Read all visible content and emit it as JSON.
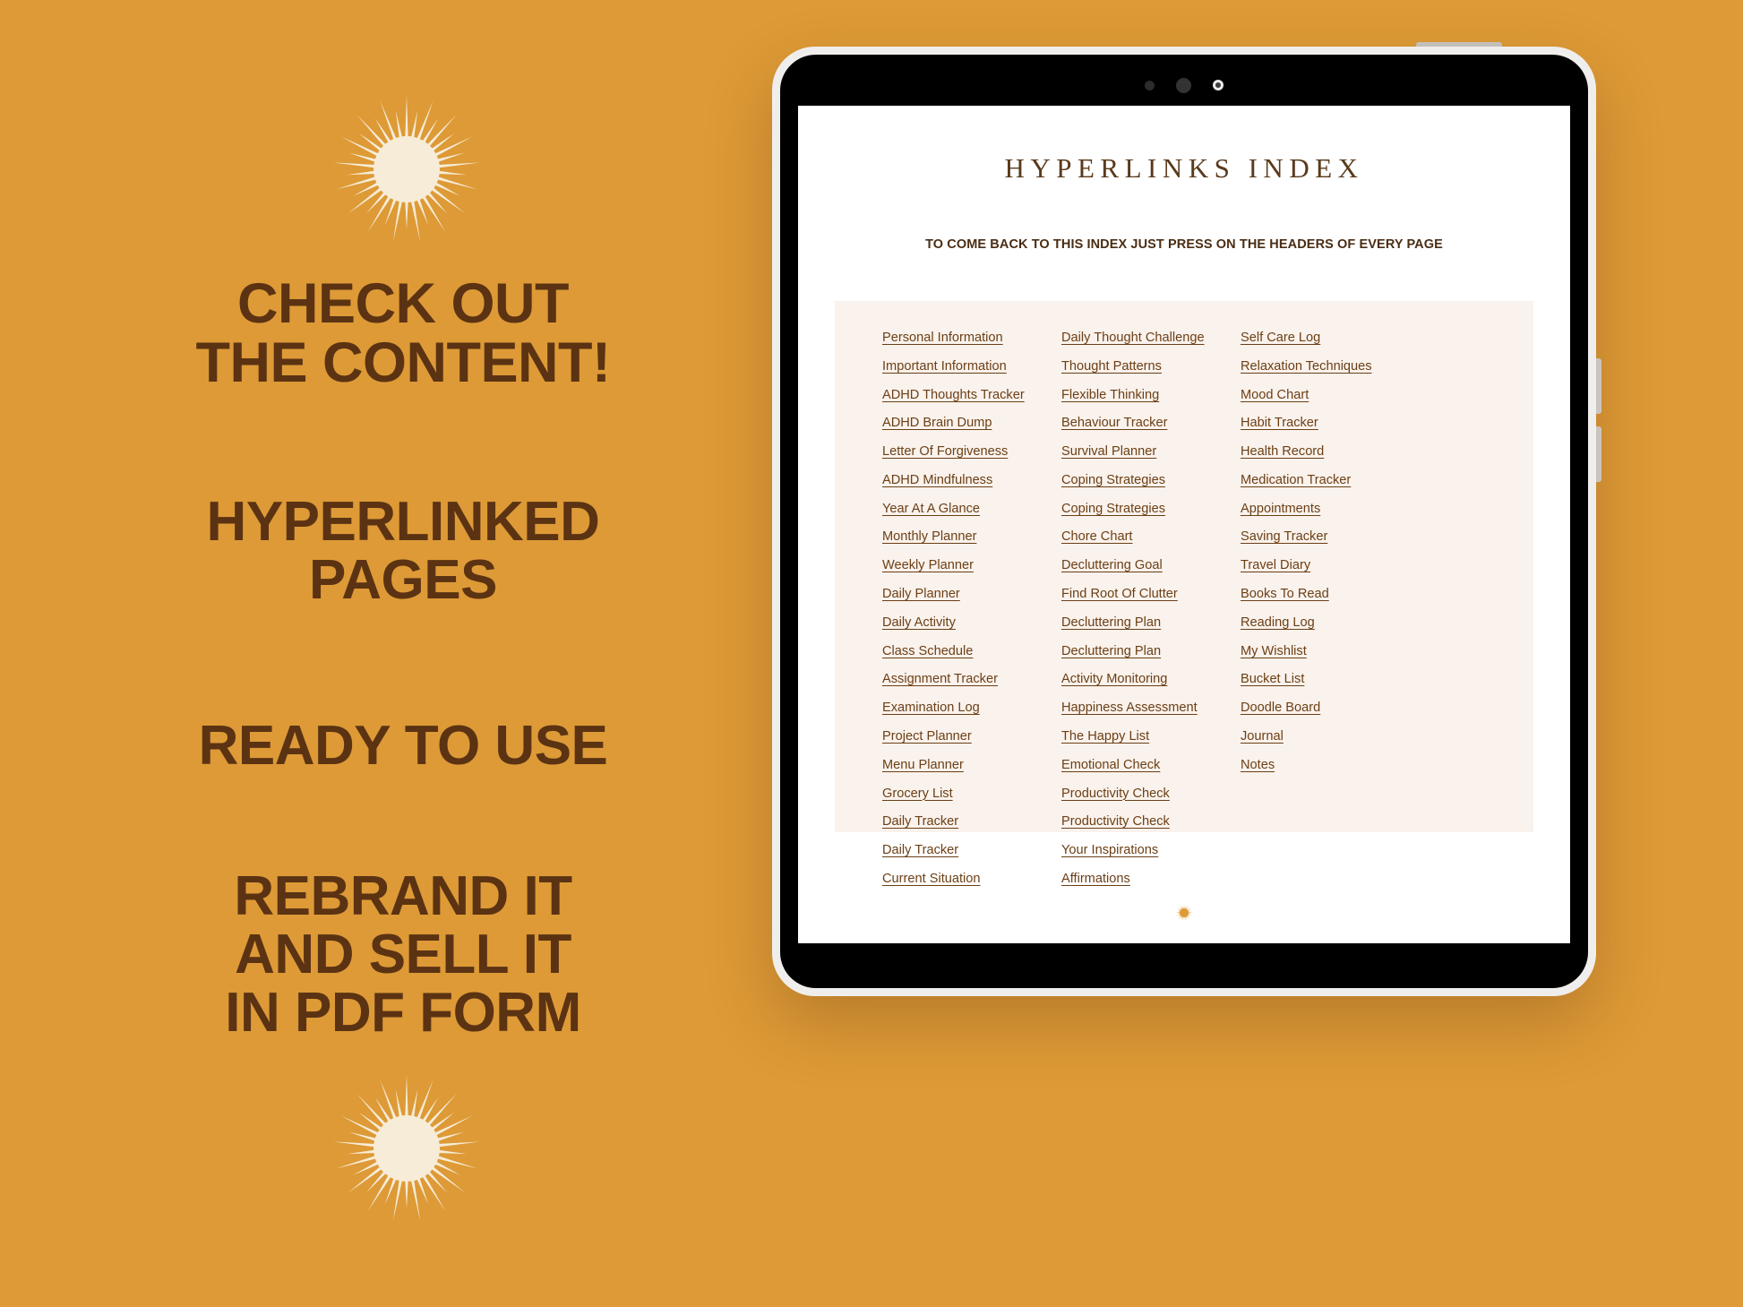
{
  "theme": {
    "background": "#dd9a36",
    "headline_color": "#5b3313",
    "link_color": "#6b3f16",
    "panel_color": "#faf2ec",
    "page_color": "#ffffff",
    "sun_color": "#f7ecd8"
  },
  "marketing": {
    "headline_1_line_1": "CHECK OUT",
    "headline_1_line_2": "THE CONTENT!",
    "headline_2_line_1": "HYPERLINKED",
    "headline_2_line_2": "PAGES",
    "headline_3_line_1": "READY TO USE",
    "headline_4_line_1": "REBRAND IT",
    "headline_4_line_2": "AND SELL IT",
    "headline_4_line_3": "IN PDF FORM"
  },
  "device": {
    "type": "tablet",
    "sensors": [
      "sensor-dot-small",
      "camera-lens",
      "indicator-light"
    ],
    "power_button": "power-button",
    "volume_up": "volume-up-button",
    "volume_down": "volume-down-button"
  },
  "document": {
    "title": "HYPERLINKS INDEX",
    "subtitle": "TO COME BACK TO THIS INDEX JUST PRESS ON THE HEADERS OF EVERY PAGE",
    "footer_icon": "sun-icon",
    "columns": [
      {
        "id": "column-1",
        "links": [
          "Personal Information",
          "Important Information",
          "ADHD Thoughts Tracker",
          "ADHD Brain Dump",
          "Letter Of Forgiveness",
          "ADHD Mindfulness",
          "Year At A Glance",
          "Monthly Planner",
          "Weekly Planner",
          "Daily Planner",
          "Daily Activity",
          "Class Schedule",
          "Assignment Tracker",
          "Examination Log",
          "Project Planner",
          "Menu Planner",
          "Grocery List",
          "Daily Tracker",
          "Daily Tracker",
          "Current Situation"
        ]
      },
      {
        "id": "column-2",
        "links": [
          "Daily Thought Challenge",
          "Thought Patterns",
          "Flexible Thinking",
          "Behaviour Tracker",
          "Survival Planner",
          "Coping Strategies",
          "Coping Strategies",
          "Chore Chart",
          "Decluttering Goal",
          "Find Root Of Clutter",
          "Decluttering Plan",
          "Decluttering Plan",
          "Activity Monitoring",
          "Happiness Assessment",
          "The Happy List",
          "Emotional Check",
          "Productivity Check",
          "Productivity Check",
          "Your Inspirations",
          "Affirmations"
        ]
      },
      {
        "id": "column-3",
        "links": [
          "Self Care Log",
          "Relaxation Techniques",
          "Mood Chart",
          "Habit Tracker",
          "Health Record",
          "Medication Tracker",
          "Appointments",
          "Saving Tracker",
          "Travel Diary",
          "Books To Read",
          "Reading Log",
          "My Wishlist",
          "Bucket List",
          "Doodle Board",
          "Journal",
          "Notes"
        ]
      }
    ]
  }
}
